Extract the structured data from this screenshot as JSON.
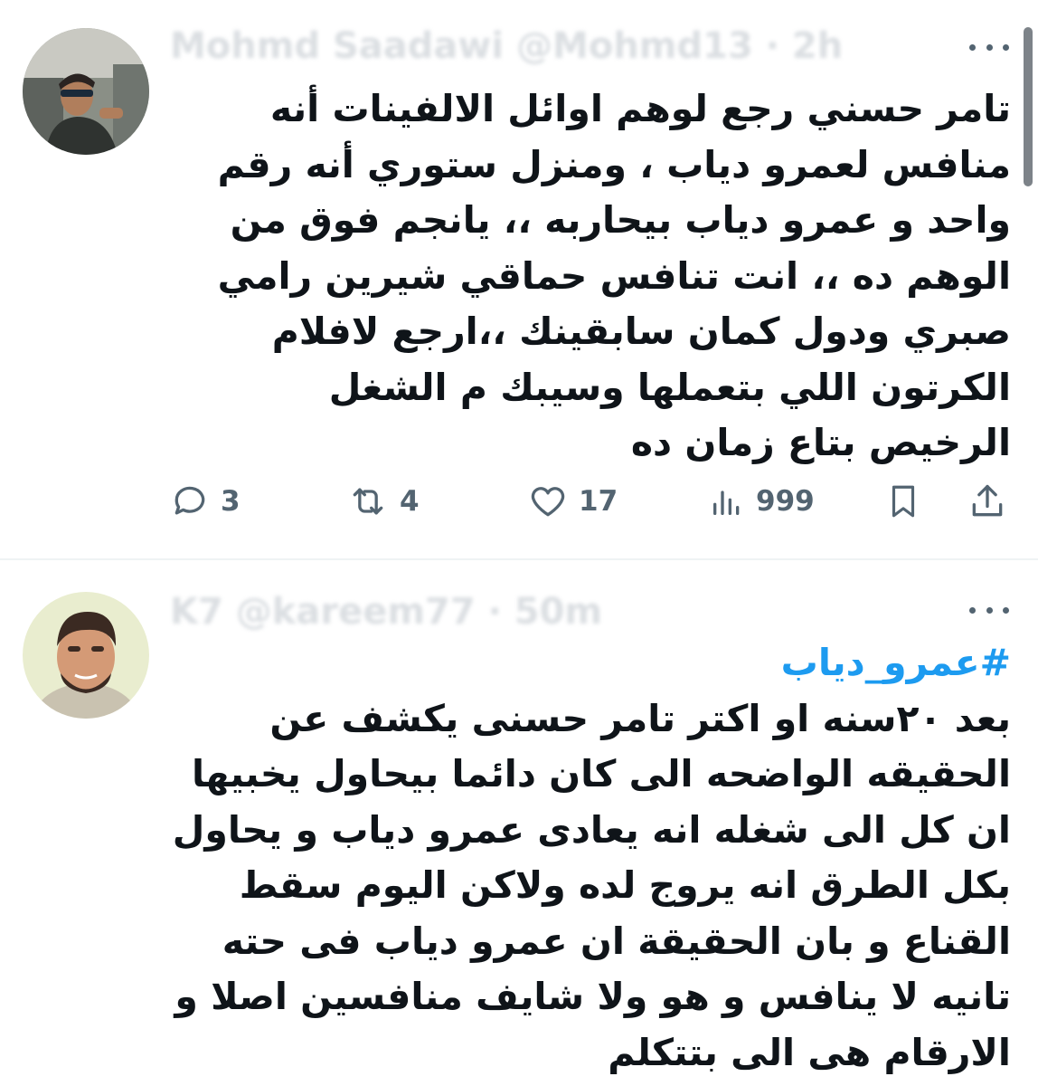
{
  "tweets": [
    {
      "author": "Mohmd Saadawi",
      "handle": "@Mohmd13",
      "time": "2h",
      "text_lines": [
        "تامر حسني رجع لوهم اوائل الالفينات أنه",
        "منافس لعمرو دياب ، ومنزل ستوري أنه رقم",
        "واحد و عمرو دياب بيحاربه ،، يانجم فوق من",
        "الوهم ده ،، انت تنافس حماقي شيرين رامي",
        "صبري ودول كمان سابقينك ،،ارجع لافلام",
        "الكرتون اللي بتعملها وسيبك م الشغل",
        "الرخيص بتاع زمان ده"
      ],
      "replies": "3",
      "reposts": "4",
      "likes": "17",
      "views": "999"
    },
    {
      "author": "K7",
      "handle": "@kareem77",
      "time": "50m",
      "hashtag": "#عمرو_دياب",
      "text_lines": [
        "بعد ٢٠سنه او اكتر تامر حسنى يكشف عن",
        "الحقيقه الواضحه الى كان دائما بيحاول يخبيها",
        "ان كل الى شغله انه يعادى عمرو دياب و يحاول",
        "بكل الطرق انه يروج لده ولاكن اليوم سقط",
        "القناع و بان الحقيقة ان عمرو دياب فى حته",
        "تانيه لا ينافس و هو ولا شايف منافسين اصلا و",
        "الارقام هى الى بتتكلم"
      ]
    }
  ],
  "icons": {
    "reply": "reply-icon",
    "repost": "repost-icon",
    "like": "like-icon",
    "views": "views-icon",
    "bookmark": "bookmark-icon",
    "share": "share-icon"
  },
  "colors": {
    "text": "#0f1419",
    "muted": "#536471",
    "hashtag": "#1d9bf0",
    "divider": "#eff3f4"
  }
}
